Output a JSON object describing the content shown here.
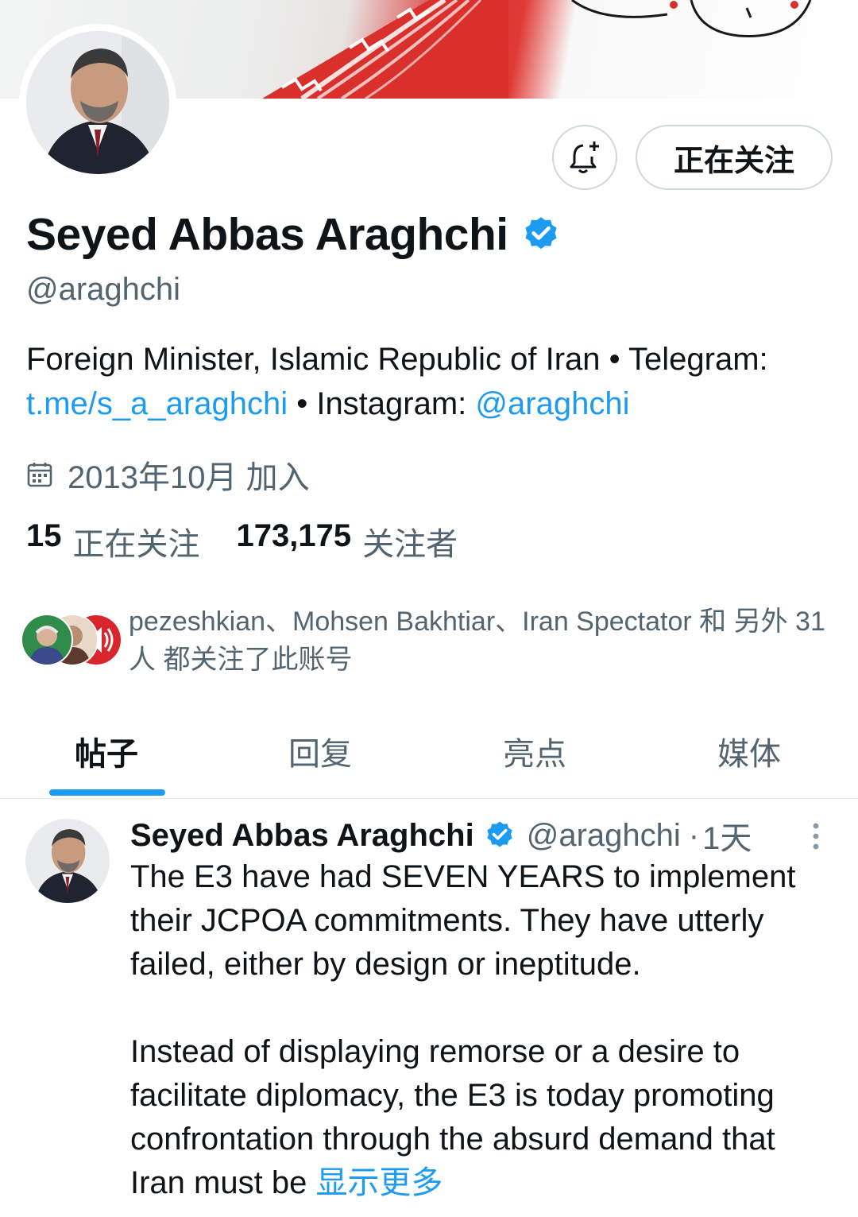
{
  "profile": {
    "display_name": "Seyed Abbas Araghchi",
    "handle": "@araghchi",
    "follow_button_label": "正在关注",
    "bio": {
      "line1": "Foreign Minister, Islamic Republic of Iran • Telegram:",
      "telegram_link": "t.me/s_a_araghchi",
      "instagram_prefix": " • Instagram: ",
      "instagram_link": "@araghchi"
    },
    "joined": "2013年10月 加入",
    "following_count": "15",
    "following_label": "正在关注",
    "followers_count": "173,175",
    "followers_label": "关注者",
    "followed_by_text": "pezeshkian、Mohsen Bakhtiar、Iran Spectator 和 另外 31 人 都关注了此账号"
  },
  "tabs": [
    {
      "label": "帖子",
      "active": true
    },
    {
      "label": "回复",
      "active": false
    },
    {
      "label": "亮点",
      "active": false
    },
    {
      "label": "媒体",
      "active": false
    }
  ],
  "post": {
    "author_name": "Seyed Abbas Araghchi",
    "author_handle": "@araghchi",
    "separator": "·",
    "time": "1天",
    "paragraph1": "The E3 have had SEVEN YEARS to implement their JCPOA commitments. They have utterly failed, either by design or ineptitude.",
    "paragraph2": "Instead of displaying remorse or a desire to facilitate diplomacy, the E3 is today promoting confrontation through the absurd demand that Iran must be ",
    "show_more": "显示更多"
  },
  "colors": {
    "accent": "#1d9bf0",
    "text_primary": "#0f1419",
    "text_secondary": "#536471",
    "border": "#cfd9de",
    "banner_red": "#da3731"
  },
  "icons": [
    "bell-plus-icon",
    "verified-badge-icon",
    "calendar-icon",
    "more-vertical-icon"
  ]
}
